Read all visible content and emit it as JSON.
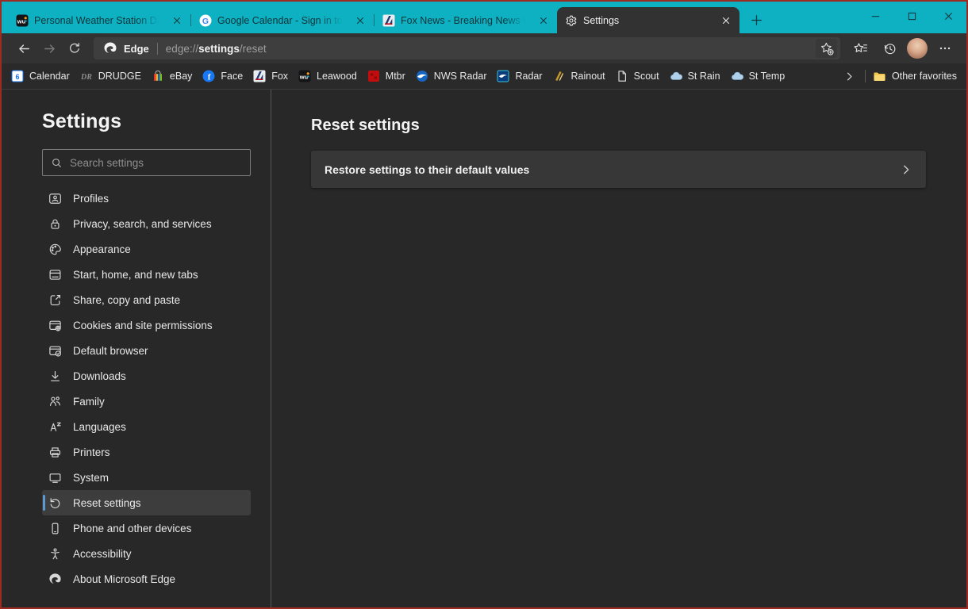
{
  "colors": {
    "titlebar": "#0db1c2",
    "accent": "#5f97d3",
    "window_border": "#9e2b22"
  },
  "titlebar": {
    "tabs": [
      {
        "title": "Personal Weather Station Dashb",
        "icon": "wunderground-icon",
        "active": false
      },
      {
        "title": "Google Calendar - Sign in to Acc",
        "icon": "google-icon",
        "active": false
      },
      {
        "title": "Fox News - Breaking News Upda",
        "icon": "fox-news-icon",
        "active": false
      },
      {
        "title": "Settings",
        "icon": "gear-icon",
        "active": true
      }
    ]
  },
  "toolbar": {
    "site_button_label": "Edge",
    "url": {
      "prefix": "edge://",
      "emphasis": "settings",
      "suffix": "/reset"
    }
  },
  "favorites_bar": {
    "items": [
      {
        "label": "Calendar",
        "icon": "google-calendar-icon"
      },
      {
        "label": "DRUDGE",
        "icon": "drudge-icon"
      },
      {
        "label": "eBay",
        "icon": "ebay-icon"
      },
      {
        "label": "Face",
        "icon": "facebook-icon"
      },
      {
        "label": "Fox",
        "icon": "fox-news-icon"
      },
      {
        "label": "Leawood",
        "icon": "wunderground-icon"
      },
      {
        "label": "Mtbr",
        "icon": "mtbr-icon"
      },
      {
        "label": "NWS Radar",
        "icon": "noaa-round-icon"
      },
      {
        "label": "Radar",
        "icon": "noaa-square-icon"
      },
      {
        "label": "Rainout",
        "icon": "rainout-icon"
      },
      {
        "label": "Scout",
        "icon": "document-icon"
      },
      {
        "label": "St Rain",
        "icon": "cloud-icon"
      },
      {
        "label": "St Temp",
        "icon": "cloud-icon"
      }
    ],
    "other_favorites_label": "Other favorites"
  },
  "settings_page": {
    "sidebar": {
      "title": "Settings",
      "search_placeholder": "Search settings",
      "menu": [
        {
          "label": "Profiles",
          "icon": "profiles-icon",
          "selected": false
        },
        {
          "label": "Privacy, search, and services",
          "icon": "lock-icon",
          "selected": false
        },
        {
          "label": "Appearance",
          "icon": "palette-icon",
          "selected": false
        },
        {
          "label": "Start, home, and new tabs",
          "icon": "new-tab-layout-icon",
          "selected": false
        },
        {
          "label": "Share, copy and paste",
          "icon": "share-icon",
          "selected": false
        },
        {
          "label": "Cookies and site permissions",
          "icon": "site-permissions-icon",
          "selected": false
        },
        {
          "label": "Default browser",
          "icon": "default-browser-icon",
          "selected": false
        },
        {
          "label": "Downloads",
          "icon": "download-icon",
          "selected": false
        },
        {
          "label": "Family",
          "icon": "family-icon",
          "selected": false
        },
        {
          "label": "Languages",
          "icon": "languages-icon",
          "selected": false
        },
        {
          "label": "Printers",
          "icon": "printer-icon",
          "selected": false
        },
        {
          "label": "System",
          "icon": "system-icon",
          "selected": false
        },
        {
          "label": "Reset settings",
          "icon": "reset-icon",
          "selected": true
        },
        {
          "label": "Phone and other devices",
          "icon": "phone-icon",
          "selected": false
        },
        {
          "label": "Accessibility",
          "icon": "accessibility-icon",
          "selected": false
        },
        {
          "label": "About Microsoft Edge",
          "icon": "edge-logo-icon",
          "selected": false
        }
      ]
    },
    "main": {
      "title": "Reset settings",
      "items": [
        {
          "label": "Restore settings to their default values"
        }
      ]
    }
  }
}
